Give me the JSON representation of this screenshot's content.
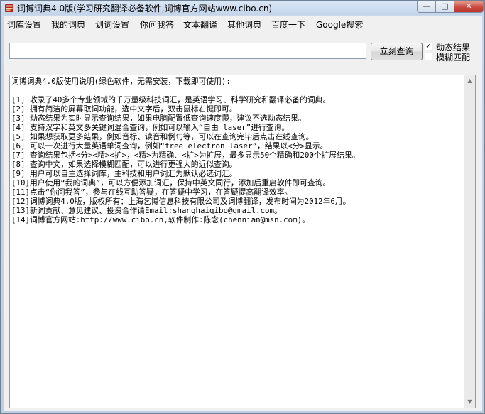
{
  "window": {
    "title": "词博词典4.0版(学习研究翻译必备软件,词博官方网站www.cibo.cn)",
    "controls": {
      "minimize": "—",
      "maximize": "□",
      "close": "✕"
    },
    "icon": "dictionary-app-icon"
  },
  "menu": {
    "items": [
      {
        "label": "词库设置"
      },
      {
        "label": "我的词典"
      },
      {
        "label": "划词设置"
      },
      {
        "label": "你问我答"
      },
      {
        "label": "文本翻译"
      },
      {
        "label": "其他词典"
      },
      {
        "label": "百度一下"
      },
      {
        "label": "Google搜索"
      }
    ]
  },
  "search": {
    "value": "",
    "placeholder": "",
    "button_label": "立刻查询",
    "options": [
      {
        "label": "动态结果",
        "checked": true,
        "mark": "✓"
      },
      {
        "label": "模糊匹配",
        "checked": false,
        "mark": ""
      }
    ]
  },
  "content": {
    "lines": [
      "词博词典4.0版使用说明(绿色软件，无需安装，下载即可使用):",
      "",
      "[1] 收录了40多个专业领域的千万量级科技词汇，是英语学习、科学研究和翻译必备的词典。",
      "[2] 拥有简洁的屏幕取词功能，选中文字后，双击鼠标右键即可。",
      "[3] 动态结果为实时显示查询结果，如果电脑配置低查询速度慢，建议不选动态结果。",
      "[4] 支持汉字和英文多关键词混合查询，例如可以输入“自由 laser”进行查询。",
      "[5] 如果想获取更多结果，例如音标、读音和例句等，可以在查询完毕后点击在线查询。",
      "[6] 可以一次进行大量英语单词查询，例如“free electron laser”，结果以<分>显示。",
      "[7] 查询结果包括<分><精><扩>，<精>为精确、<扩>为扩展，最多显示50个精确和200个扩展结果。",
      "[8] 查询中文，如果选择模糊匹配，可以进行更强大的近似查询。",
      "[9] 用户可以自主选择词库，主科技和用户词汇为默认必选词汇。",
      "[10]用户使用“我的词典”，可以方便添加词汇，保持中英文同行，添加后重启软件即可查询。",
      "[11]点击“你问我答”，参与在线互助答疑，在答疑中学习，在答疑提高翻译效率。",
      "[12]词博词典4.0版，版权所有：上海乞博信息科技有限公司及词博翻译，发布时间为2012年6月。",
      "[13]新词贡献、意见建议、投资合作请Email:shanghaiqibo@gmail.com。",
      "[14]词博官方网站:http://www.cibo.cn,软件制作:陈念(chennian@msn.com)。"
    ]
  },
  "scrollbar": {
    "up": "▲",
    "down": "▼"
  },
  "colors": {
    "titlebar": "#c4d5ea",
    "client": "#f0f0f0",
    "close_button": "#c9463d"
  }
}
